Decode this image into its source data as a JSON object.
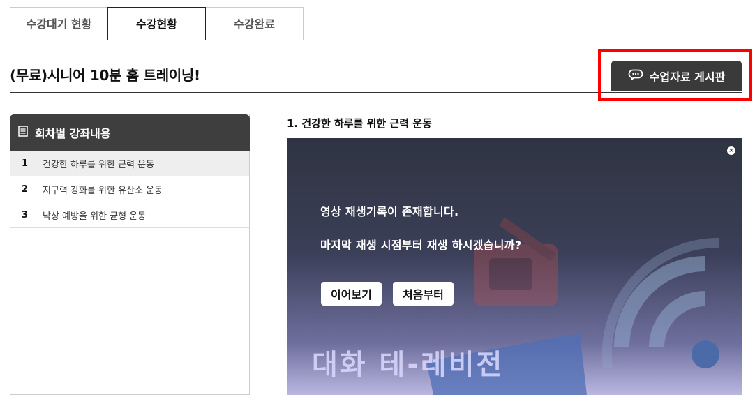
{
  "tabs": [
    {
      "label": "수강대기 현황",
      "active": false
    },
    {
      "label": "수강현황",
      "active": true
    },
    {
      "label": "수강완료",
      "active": false
    }
  ],
  "course": {
    "title": "(무료)시니어 10분 홈 트레이닝!"
  },
  "board_button": {
    "label": "수업자료 게시판",
    "icon": "chat-bubble-icon"
  },
  "sidebar": {
    "title": "회차별 강좌내용",
    "icon": "document-list-icon",
    "items": [
      {
        "num": "1",
        "label": "건강한 하루를 위한 근력 운동",
        "active": true
      },
      {
        "num": "2",
        "label": "지구력 강화를 위한 유산소 운동",
        "active": false
      },
      {
        "num": "3",
        "label": "낙상 예방을 위한 균형 운동",
        "active": false
      }
    ]
  },
  "lesson": {
    "title": "1. 건강한 하루를 위한 근력 운동"
  },
  "video": {
    "message_line1": "영상 재생기록이 존재합니다.",
    "message_line2": "마지막 재생 시점부터 재생 하시겠습니까?",
    "resume_label": "이어보기",
    "restart_label": "처음부터",
    "close_symbol": "×",
    "logo_text": "대화 테-레비전"
  },
  "colors": {
    "highlight": "#ff0000",
    "dark": "#3a3a3a"
  }
}
